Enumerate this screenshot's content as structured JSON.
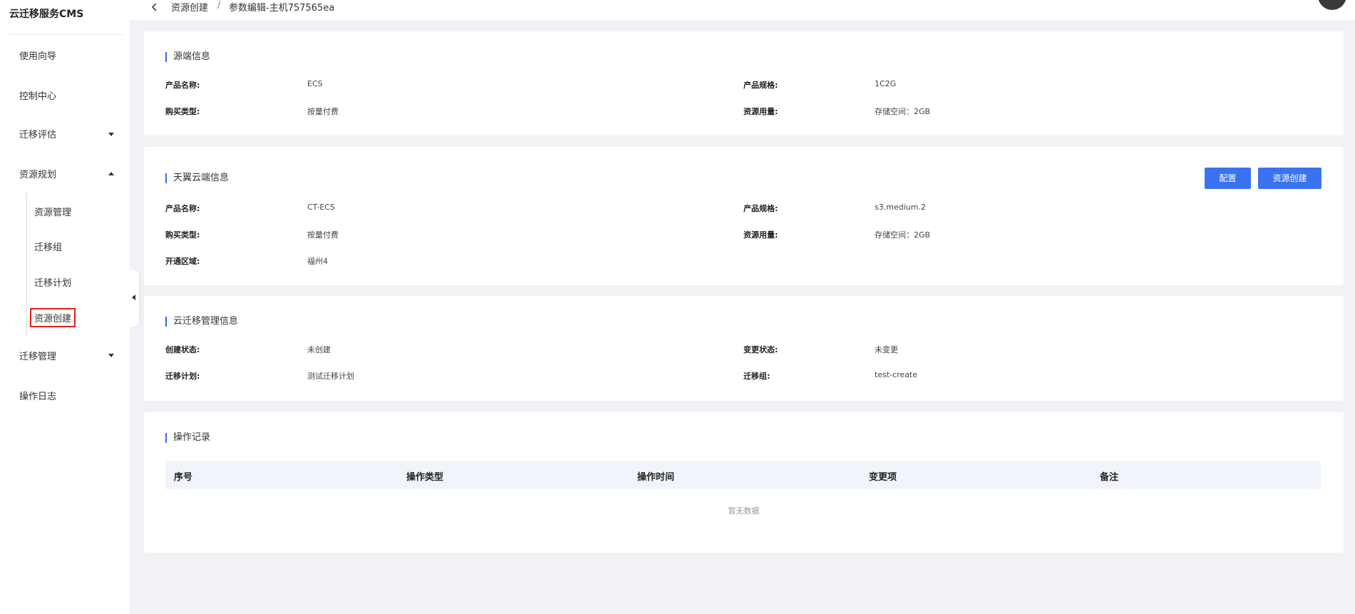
{
  "app": {
    "title": "云迁移服务CMS"
  },
  "sidebar": {
    "items": [
      {
        "label": "使用向导"
      },
      {
        "label": "控制中心"
      },
      {
        "label": "迁移评估"
      },
      {
        "label": "资源规划"
      },
      {
        "label": "迁移管理"
      },
      {
        "label": "操作日志"
      }
    ],
    "sub_items": [
      {
        "label": "资源管理"
      },
      {
        "label": "迁移组"
      },
      {
        "label": "迁移计划"
      },
      {
        "label": "资源创建"
      }
    ]
  },
  "breadcrumb": {
    "back_icon": "chevron-left-icon",
    "parent": "资源创建",
    "separator": "/",
    "current": "参数编辑-主机757565ea"
  },
  "source": {
    "title": "源端信息",
    "product_name_label": "产品名称:",
    "product_name": "ECS",
    "spec_label": "产品规格:",
    "spec": "1C2G",
    "purchase_label": "购买类型:",
    "purchase": "按量付费",
    "usage_label": "资源用量:",
    "usage": "存储空间：2GB"
  },
  "target": {
    "title": "天翼云端信息",
    "config_button": "配置",
    "create_button": "资源创建",
    "product_name_label": "产品名称:",
    "product_name": "CT-ECS",
    "spec_label": "产品规格:",
    "spec": "s3.medium.2",
    "purchase_label": "购买类型:",
    "purchase": "按量付费",
    "usage_label": "资源用量:",
    "usage": "存储空间：2GB",
    "region_label": "开通区域:",
    "region": "福州4"
  },
  "management": {
    "title": "云迁移管理信息",
    "create_status_label": "创建状态:",
    "create_status": "未创建",
    "change_status_label": "变更状态:",
    "change_status": "未变更",
    "plan_label": "迁移计划:",
    "plan": "测试迁移计划",
    "group_label": "迁移组:",
    "group": "test-create"
  },
  "records": {
    "title": "操作记录",
    "columns": [
      "序号",
      "操作类型",
      "操作时间",
      "变更项",
      "备注"
    ],
    "empty_text": "暂无数据"
  },
  "colors": {
    "accent": "#3a73f0",
    "highlight": "#e0201a",
    "background": "#f0f2f5"
  }
}
